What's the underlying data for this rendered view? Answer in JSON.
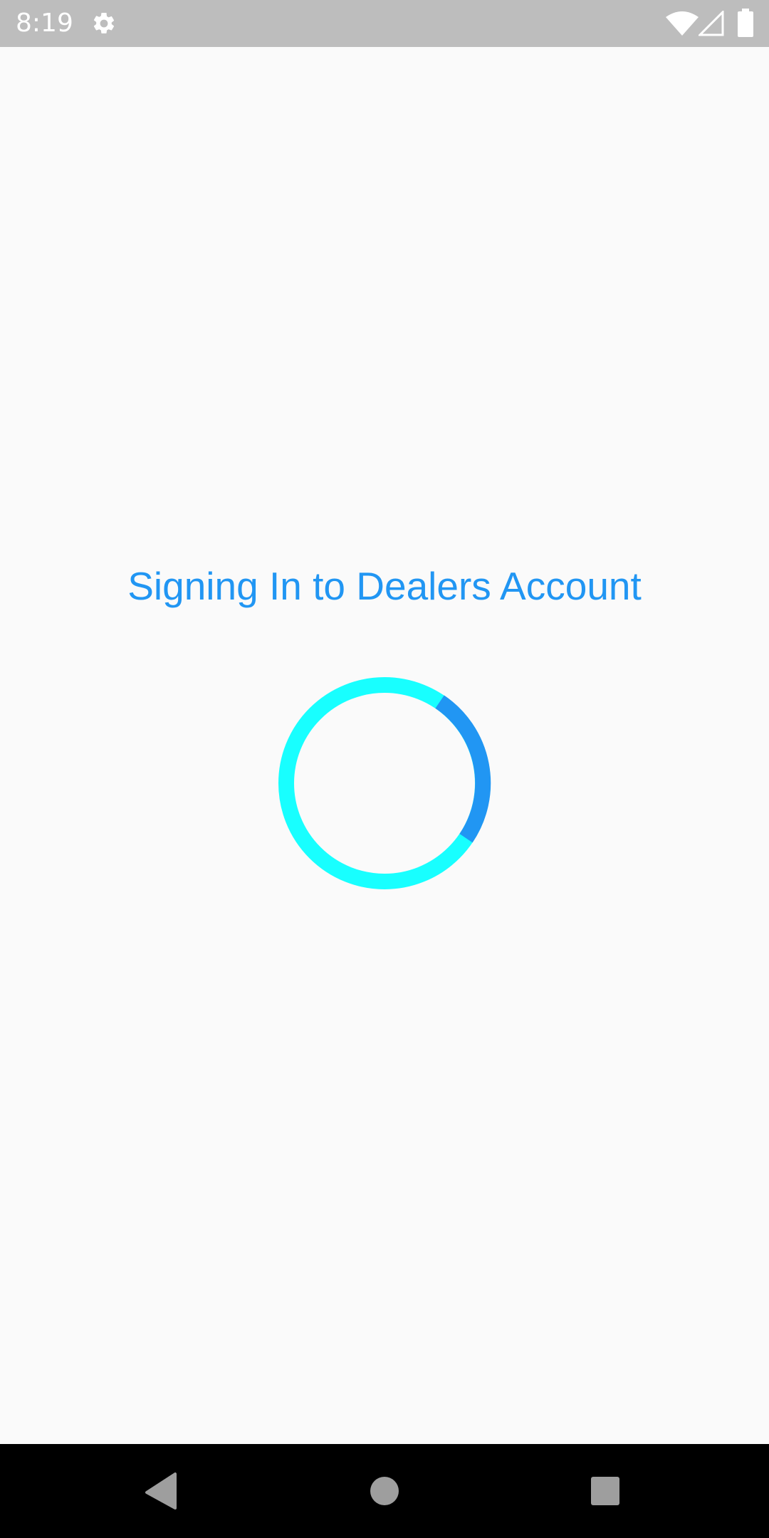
{
  "status_bar": {
    "time": "8:19",
    "icons": [
      "gear-icon",
      "wifi-icon",
      "signal-icon",
      "battery-icon"
    ],
    "background_color": "#bdbdbd"
  },
  "main": {
    "title": "Signing In to Dealers Account",
    "title_color": "#2196f3",
    "spinner": {
      "ring_color": "#18ffff",
      "arc_color": "#2196f3"
    }
  },
  "nav_bar": {
    "buttons": [
      "back-icon",
      "home-icon",
      "recents-icon"
    ]
  }
}
